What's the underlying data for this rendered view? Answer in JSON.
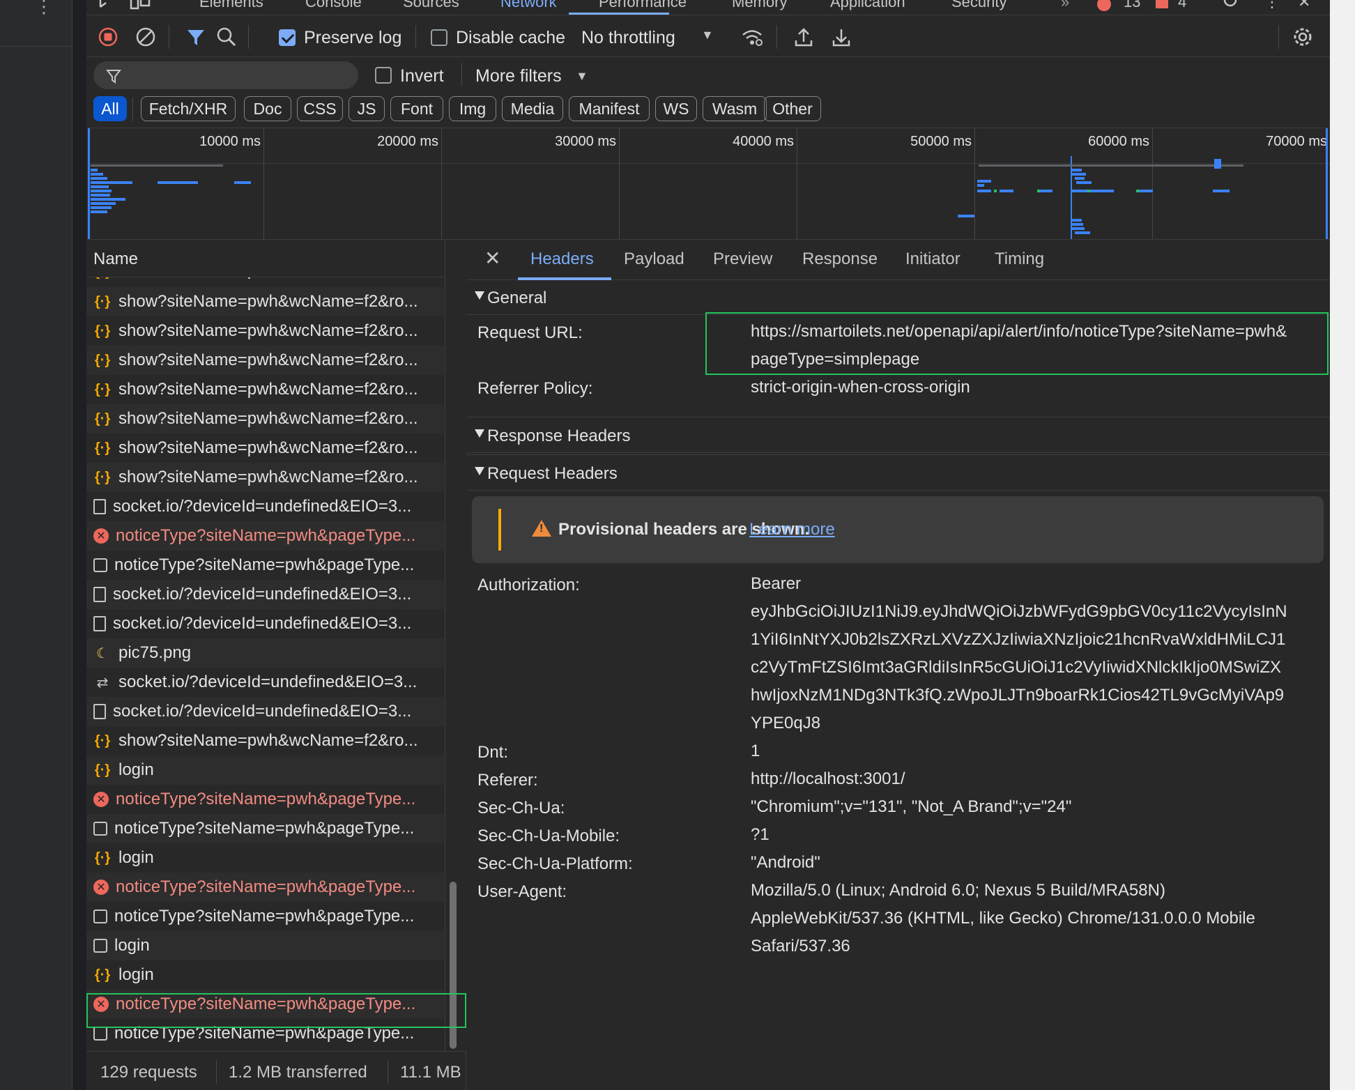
{
  "top_tabs": [
    {
      "label": "Elements"
    },
    {
      "label": "Console"
    },
    {
      "label": "Sources"
    },
    {
      "label": "Network"
    },
    {
      "label": "Performance"
    },
    {
      "label": "Memory"
    },
    {
      "label": "Application"
    },
    {
      "label": "Security"
    }
  ],
  "badges": {
    "errors": "13",
    "warnings": "4"
  },
  "toolbar": {
    "preserve_log": "Preserve log",
    "disable_cache": "Disable cache",
    "throttling": "No throttling"
  },
  "filter": {
    "placeholder": "",
    "invert": "Invert",
    "more_filters": "More filters"
  },
  "type_chips": [
    "All",
    "Fetch/XHR",
    "Doc",
    "CSS",
    "JS",
    "Font",
    "Img",
    "Media",
    "Manifest",
    "WS",
    "Wasm",
    "Other"
  ],
  "timeline": {
    "ticks": [
      "10000 ms",
      "20000 ms",
      "30000 ms",
      "40000 ms",
      "50000 ms",
      "60000 ms",
      "70000 ms"
    ]
  },
  "list": {
    "header": "Name",
    "rows": [
      {
        "icon": "xhr",
        "name": "show?siteName=pwh&wcName=f2&ro...",
        "error": false
      },
      {
        "icon": "xhr",
        "name": "show?siteName=pwh&wcName=f2&ro...",
        "error": false
      },
      {
        "icon": "xhr",
        "name": "show?siteName=pwh&wcName=f2&ro...",
        "error": false
      },
      {
        "icon": "xhr",
        "name": "show?siteName=pwh&wcName=f2&ro...",
        "error": false
      },
      {
        "icon": "xhr",
        "name": "show?siteName=pwh&wcName=f2&ro...",
        "error": false
      },
      {
        "icon": "xhr",
        "name": "show?siteName=pwh&wcName=f2&ro...",
        "error": false
      },
      {
        "icon": "xhr",
        "name": "show?siteName=pwh&wcName=f2&ro...",
        "error": false
      },
      {
        "icon": "doc",
        "name": "socket.io/?deviceId=undefined&EIO=3...",
        "error": false
      },
      {
        "icon": "err",
        "name": "noticeType?siteName=pwh&pageType...",
        "error": true
      },
      {
        "icon": "box",
        "name": "noticeType?siteName=pwh&pageType...",
        "error": false
      },
      {
        "icon": "doc",
        "name": "socket.io/?deviceId=undefined&EIO=3...",
        "error": false
      },
      {
        "icon": "doc",
        "name": "socket.io/?deviceId=undefined&EIO=3...",
        "error": false
      },
      {
        "icon": "img",
        "name": "pic75.png",
        "error": false
      },
      {
        "icon": "ws",
        "name": "socket.io/?deviceId=undefined&EIO=3...",
        "error": false
      },
      {
        "icon": "doc",
        "name": "socket.io/?deviceId=undefined&EIO=3...",
        "error": false
      },
      {
        "icon": "xhr",
        "name": "show?siteName=pwh&wcName=f2&ro...",
        "error": false
      },
      {
        "icon": "xhr",
        "name": "login",
        "error": false
      },
      {
        "icon": "err",
        "name": "noticeType?siteName=pwh&pageType...",
        "error": true
      },
      {
        "icon": "box",
        "name": "noticeType?siteName=pwh&pageType...",
        "error": false
      },
      {
        "icon": "xhr",
        "name": "login",
        "error": false
      },
      {
        "icon": "err",
        "name": "noticeType?siteName=pwh&pageType...",
        "error": true
      },
      {
        "icon": "box",
        "name": "noticeType?siteName=pwh&pageType...",
        "error": false
      },
      {
        "icon": "box",
        "name": "login",
        "error": false
      },
      {
        "icon": "xhr",
        "name": "login",
        "error": false
      },
      {
        "icon": "err",
        "name": "noticeType?siteName=pwh&pageType...",
        "error": true
      },
      {
        "icon": "box",
        "name": "noticeType?siteName=pwh&pageType...",
        "error": false
      }
    ]
  },
  "status": {
    "requests": "129 requests",
    "transferred": "1.2 MB transferred",
    "resources": "11.1 MB"
  },
  "detail_tabs": [
    "Headers",
    "Payload",
    "Preview",
    "Response",
    "Initiator",
    "Timing"
  ],
  "general": {
    "title": "General",
    "request_url_key": "Request URL:",
    "request_url_l1": "https://smartoilets.net/openapi/api/alert/info/noticeType?siteName=pwh&",
    "request_url_l2": "pageType=simplepage",
    "referrer_policy_key": "Referrer Policy:",
    "referrer_policy": "strict-origin-when-cross-origin"
  },
  "response_headers": {
    "title": "Response Headers"
  },
  "request_headers": {
    "title": "Request Headers",
    "warning": "Provisional headers are shown.",
    "learn_more": "Learn more",
    "authorization_key": "Authorization:",
    "authorization_lines": [
      "Bearer",
      "eyJhbGciOiJIUzI1NiJ9.eyJhdWQiOiJzbWFydG9pbGV0cy11c2VycyIsInN",
      "1YiI6InNtYXJ0b2lsZXRzLXVzZXJzIiwiaXNzIjoic21hcnRvaWxldHMiLCJ1",
      "c2VyTmFtZSI6Imt3aGRldiIsInR5cGUiOiJ1c2VyIiwidXNlckIkIjo0MSwiZX",
      "hwIjoxNzM1NDg3NTk3fQ.zWpoJLJTn9boarRk1Cios42TL9vGcMyiVAp9",
      "YPE0qJ8"
    ],
    "dnt_key": "Dnt:",
    "dnt": "1",
    "referer_key": "Referer:",
    "referer": "http://localhost:3001/",
    "sec_ch_ua_key": "Sec-Ch-Ua:",
    "sec_ch_ua": "\"Chromium\";v=\"131\", \"Not_A Brand\";v=\"24\"",
    "sec_ch_ua_mobile_key": "Sec-Ch-Ua-Mobile:",
    "sec_ch_ua_mobile": "?1",
    "sec_ch_ua_platform_key": "Sec-Ch-Ua-Platform:",
    "sec_ch_ua_platform": "\"Android\"",
    "user_agent_key": "User-Agent:",
    "user_agent_lines": [
      "Mozilla/5.0 (Linux; Android 6.0; Nexus 5 Build/MRA58N)",
      "AppleWebKit/537.36 (KHTML, like Gecko) Chrome/131.0.0.0 Mobile",
      "Safari/537.36"
    ]
  }
}
